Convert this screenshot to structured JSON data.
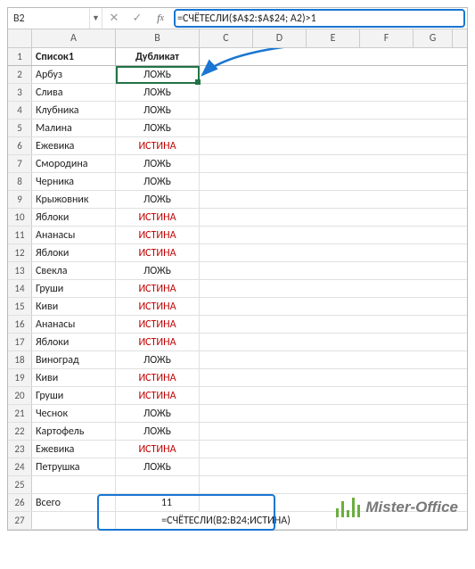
{
  "namebox": {
    "value": "B2"
  },
  "formula_bar": {
    "formula": "=СЧЁТЕСЛИ($A$2:$A$24; A2)>1"
  },
  "columns": [
    "A",
    "B",
    "C",
    "D",
    "E",
    "F",
    "G"
  ],
  "headers": {
    "A": "Список1",
    "B": "Дубликат"
  },
  "rows": [
    {
      "n": 2,
      "a": "Арбуз",
      "b": "ЛОЖЬ",
      "red": false
    },
    {
      "n": 3,
      "a": "Слива",
      "b": "ЛОЖЬ",
      "red": false
    },
    {
      "n": 4,
      "a": "Клубника",
      "b": "ЛОЖЬ",
      "red": false
    },
    {
      "n": 5,
      "a": "Малина",
      "b": "ЛОЖЬ",
      "red": false
    },
    {
      "n": 6,
      "a": "Ежевика",
      "b": "ИСТИНА",
      "red": true
    },
    {
      "n": 7,
      "a": "Смородина",
      "b": "ЛОЖЬ",
      "red": false
    },
    {
      "n": 8,
      "a": "Черника",
      "b": "ЛОЖЬ",
      "red": false
    },
    {
      "n": 9,
      "a": "Крыжовник",
      "b": "ЛОЖЬ",
      "red": false
    },
    {
      "n": 10,
      "a": "Яблоки",
      "b": "ИСТИНА",
      "red": true
    },
    {
      "n": 11,
      "a": "Ананасы",
      "b": "ИСТИНА",
      "red": true
    },
    {
      "n": 12,
      "a": "Яблоки",
      "b": "ИСТИНА",
      "red": true
    },
    {
      "n": 13,
      "a": "Свекла",
      "b": "ЛОЖЬ",
      "red": false
    },
    {
      "n": 14,
      "a": "Груши",
      "b": "ИСТИНА",
      "red": true
    },
    {
      "n": 15,
      "a": "Киви",
      "b": "ИСТИНА",
      "red": true
    },
    {
      "n": 16,
      "a": "Ананасы",
      "b": "ИСТИНА",
      "red": true
    },
    {
      "n": 17,
      "a": "Яблоки",
      "b": "ИСТИНА",
      "red": true
    },
    {
      "n": 18,
      "a": "Виноград",
      "b": "ЛОЖЬ",
      "red": false
    },
    {
      "n": 19,
      "a": "Киви",
      "b": "ИСТИНА",
      "red": true
    },
    {
      "n": 20,
      "a": "Груши",
      "b": "ИСТИНА",
      "red": true
    },
    {
      "n": 21,
      "a": "Чеснок",
      "b": "ЛОЖЬ",
      "red": false
    },
    {
      "n": 22,
      "a": "Картофель",
      "b": "ЛОЖЬ",
      "red": false
    },
    {
      "n": 23,
      "a": "Ежевика",
      "b": "ИСТИНА",
      "red": true
    },
    {
      "n": 24,
      "a": "Петрушка",
      "b": "ЛОЖЬ",
      "red": false
    }
  ],
  "total_row": {
    "n": 26,
    "label": "Всего",
    "value": "11"
  },
  "formula_row": {
    "n": 27,
    "text": "=СЧЁТЕСЛИ(B2:B24;ИСТИНА)"
  },
  "empty_rows": [
    25
  ],
  "watermark": {
    "text": "Mister-Office"
  }
}
